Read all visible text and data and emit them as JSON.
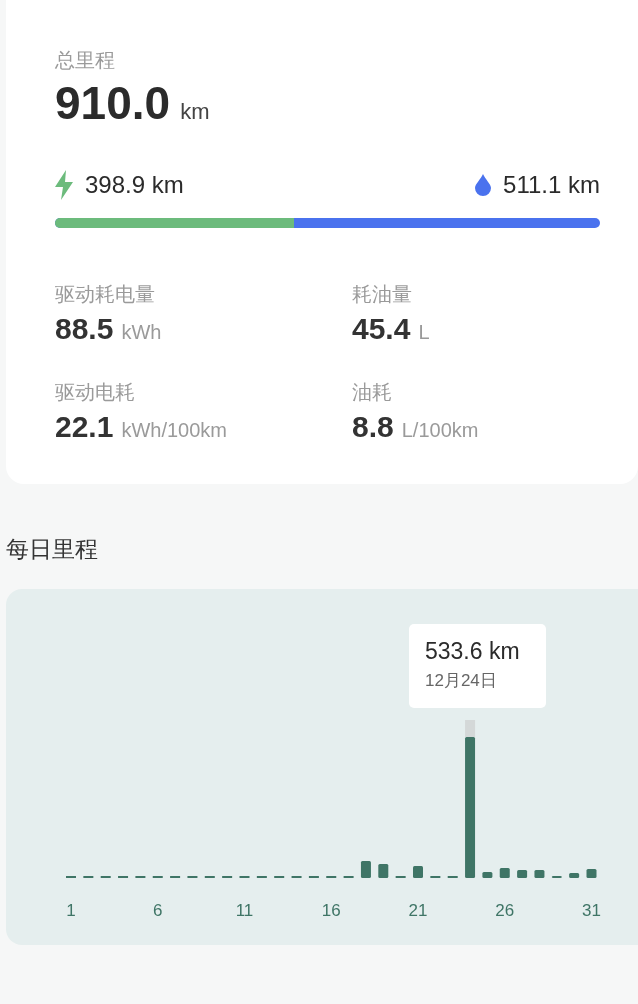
{
  "summary": {
    "label": "总里程",
    "value": "910.0",
    "unit": "km",
    "electric": {
      "value": "398.9 km"
    },
    "fuel": {
      "value": "511.1 km"
    },
    "split_bar": {
      "level": 0.438
    },
    "stats": [
      {
        "label": "驱动耗电量",
        "value": "88.5",
        "unit": "kWh"
      },
      {
        "label": "耗油量",
        "value": "45.4",
        "unit": "L"
      },
      {
        "label": "驱动电耗",
        "value": "22.1",
        "unit": "kWh/100km"
      },
      {
        "label": "油耗",
        "value": "8.8",
        "unit": "L/100km"
      }
    ]
  },
  "daily": {
    "title": "每日里程",
    "tooltip": {
      "value": "533.6 km",
      "date": "12月24日"
    },
    "x_labels": [
      "1",
      "6",
      "11",
      "16",
      "21",
      "26",
      "31"
    ]
  }
}
